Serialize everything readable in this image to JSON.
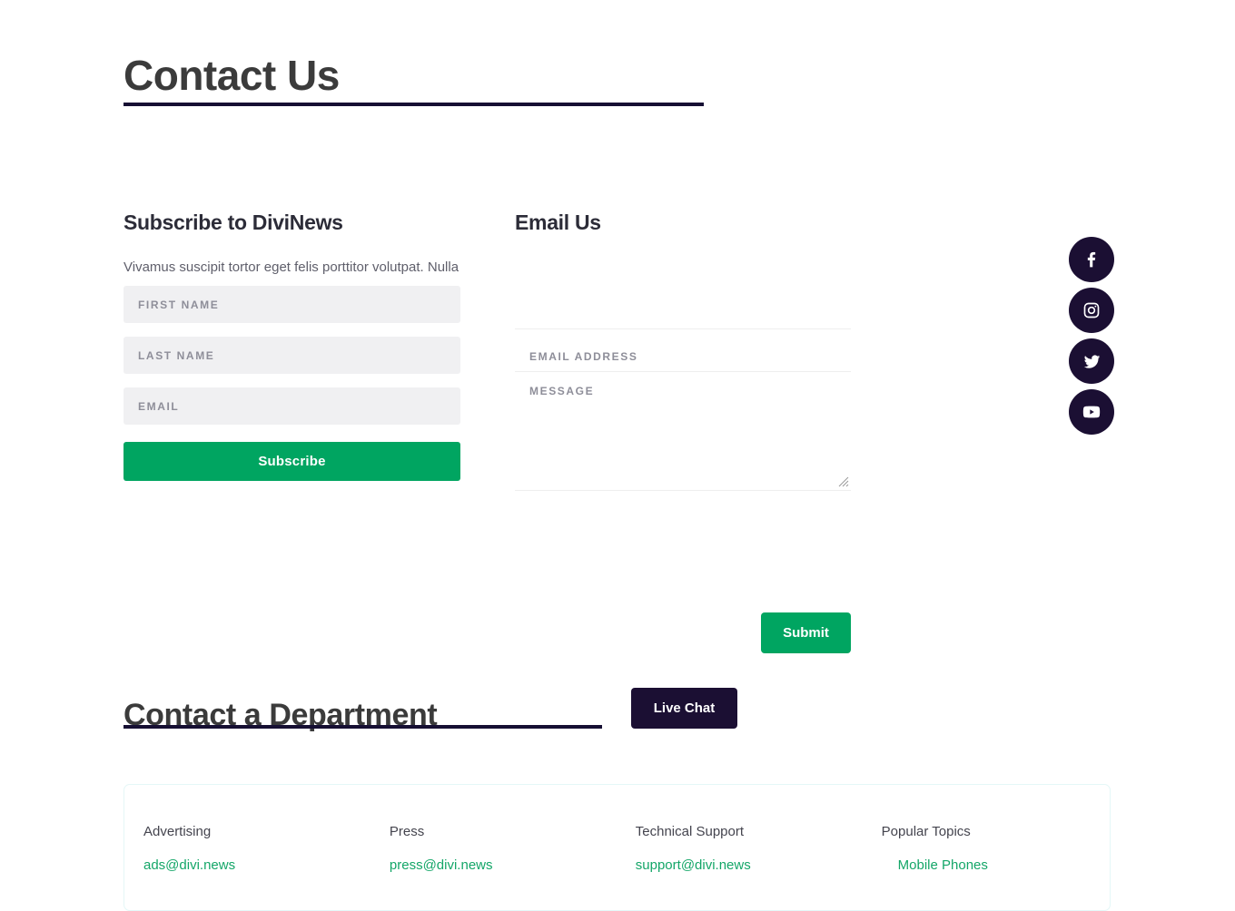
{
  "page": {
    "title": "Contact Us"
  },
  "subscribe": {
    "heading": "Subscribe to DiviNews",
    "paragraph": "Vivamus suscipit tortor eget felis porttitor volutpat. Nulla e",
    "fields": [
      {
        "name": "first-name",
        "placeholder": "FIRST NAME",
        "value": ""
      },
      {
        "name": "last-name",
        "placeholder": "LAST NAME",
        "value": ""
      },
      {
        "name": "email",
        "placeholder": "EMAIL",
        "value": ""
      }
    ],
    "button_label": "Subscribe"
  },
  "email_us": {
    "heading": "Email Us",
    "fields": [
      {
        "name": "name",
        "placeholder": "",
        "value": ""
      },
      {
        "name": "email-address",
        "placeholder": "EMAIL ADDRESS",
        "value": ""
      },
      {
        "name": "message",
        "placeholder": "MESSAGE",
        "value": ""
      }
    ],
    "button_label": "Submit"
  },
  "social": {
    "items": [
      {
        "icon": "facebook-icon",
        "label": "Facebook"
      },
      {
        "icon": "instagram-icon",
        "label": "Instagram"
      },
      {
        "icon": "twitter-icon",
        "label": "Twitter"
      },
      {
        "icon": "youtube-icon",
        "label": "YouTube"
      }
    ]
  },
  "department": {
    "heading": "Contact a Department",
    "chat_button_label": "Live Chat",
    "columns": [
      {
        "title": "Advertising",
        "link": "ads@divi.news"
      },
      {
        "title": "Press",
        "link": "press@divi.news"
      },
      {
        "title": "Technical Support",
        "link": "support@divi.news"
      },
      {
        "title": "Popular Topics",
        "topics": [
          "Mobile Phones"
        ]
      }
    ]
  },
  "colors": {
    "accent_green": "#00a561",
    "link_green": "#14a668",
    "dark_navy": "#1b0f33",
    "rule_navy": "#160f33",
    "field_bg": "#f0f0f2",
    "card_border": "#e4f7f7"
  }
}
